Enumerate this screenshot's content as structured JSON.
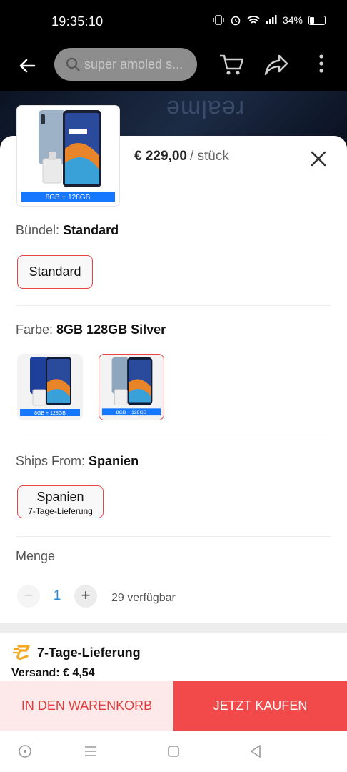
{
  "status_bar": {
    "time": "19:35:10",
    "battery": "34%",
    "battery_level": 0.34
  },
  "top_bar": {
    "search_text": "super amoled s..."
  },
  "product": {
    "price": "€ 229,00",
    "unit": "/ stück",
    "thumb_caption": "8GB + 128GB"
  },
  "bundle": {
    "label": "Bündel:",
    "value": "Standard",
    "option": "Standard"
  },
  "color": {
    "label": "Farbe:",
    "value": "8GB 128GB Silver",
    "options": [
      {
        "caption": "8GB + 128GB",
        "tint": "#1e3f9a"
      },
      {
        "caption": "8GB + 128GB",
        "tint": "#8fa6bf"
      }
    ]
  },
  "ships_from": {
    "label": "Ships From:",
    "value": "Spanien",
    "option": "Spanien",
    "option_sub": "7-Tage-Lieferung"
  },
  "quantity": {
    "label": "Menge",
    "minus": "−",
    "value": "1",
    "plus": "+",
    "available": "29 verfügbar"
  },
  "shipping": {
    "title": "7-Tage-Lieferung",
    "cost": "Versand: € 4,54"
  },
  "actions": {
    "add_to_cart": "IN DEN WARENKORB",
    "buy_now": "JETZT KAUFEN"
  },
  "colors": {
    "accent": "#f24a4a",
    "accent_light": "#fde9e9",
    "link": "#2b8ad8",
    "shipping_icon": "#f5a623"
  },
  "icons": [
    "back-arrow-icon",
    "search-icon",
    "cart-icon",
    "share-icon",
    "more-icon",
    "close-icon",
    "shipping-icon",
    "nav-home-icon",
    "nav-menu-icon",
    "nav-recents-icon",
    "nav-back-icon"
  ]
}
